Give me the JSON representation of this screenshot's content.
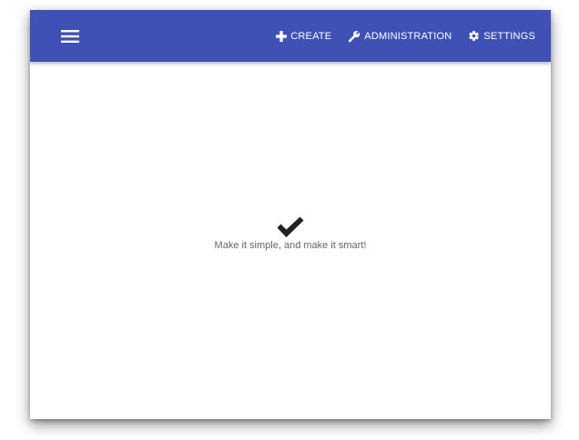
{
  "colors": {
    "appbar": "#3f51b5",
    "appbar_text": "#ffffff",
    "tagline_text": "#666666",
    "check": "#212121"
  },
  "appbar": {
    "menu_icon": "hamburger-menu-icon",
    "actions": [
      {
        "label": "CREATE",
        "icon": "plus-icon"
      },
      {
        "label": "ADMINISTRATION",
        "icon": "wrench-icon"
      },
      {
        "label": "SETTINGS",
        "icon": "gear-icon"
      }
    ]
  },
  "main": {
    "icon": "checkmark-icon",
    "tagline": "Make it simple, and make it smart!"
  }
}
